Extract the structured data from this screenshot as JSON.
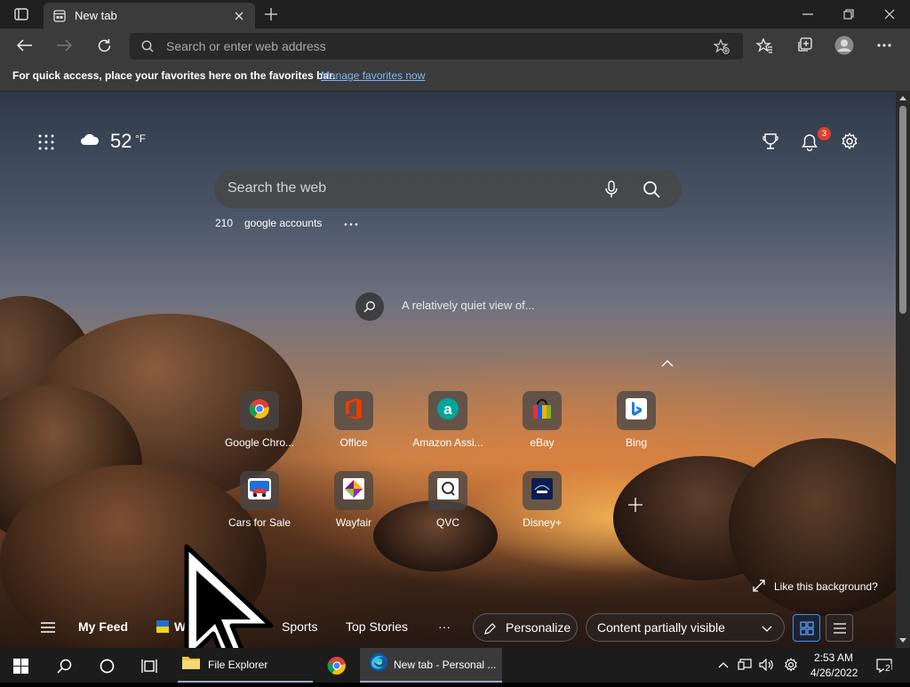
{
  "browser": {
    "tab_title": "New tab",
    "address_placeholder": "Search or enter web address",
    "favorites_message": "For quick access, place your favorites here on the favorites bar.",
    "favorites_link": "Manage favorites now"
  },
  "newtab": {
    "weather_temp": "52",
    "weather_unit": "°F",
    "notification_count": "3",
    "search_placeholder": "Search the web",
    "trending": [
      {
        "count": "210",
        "label": "google accounts"
      }
    ],
    "image_caption": "A relatively quiet view of...",
    "like_background": "Like this background?",
    "tiles": [
      {
        "label": "Google Chro...",
        "icon": "chrome-icon"
      },
      {
        "label": "Office",
        "icon": "office-icon"
      },
      {
        "label": "Amazon Assi...",
        "icon": "amazon-icon"
      },
      {
        "label": "eBay",
        "icon": "ebay-icon"
      },
      {
        "label": "Bing",
        "icon": "bing-icon"
      },
      {
        "label": "Cars for Sale",
        "icon": "car-icon"
      },
      {
        "label": "Wayfair",
        "icon": "wayfair-icon"
      },
      {
        "label": "QVC",
        "icon": "qvc-icon"
      },
      {
        "label": "Disney+",
        "icon": "disney-icon"
      }
    ],
    "feed": {
      "my_feed": "My Feed",
      "second_item": "W",
      "sports": "Sports",
      "top_stories": "Top Stories",
      "more": "···",
      "personalize": "Personalize",
      "content_visibility": "Content partially visible"
    }
  },
  "taskbar": {
    "file_explorer": "File Explorer",
    "file_explorer_partial_a": "File",
    "file_explorer_partial_b": "rer",
    "edge_window": "New tab - Personal ...",
    "time": "2:53 AM",
    "date": "4/26/2022",
    "notifications": "2"
  },
  "colors": {
    "accent": "#0078d4",
    "link": "#7cb8ff",
    "badge": "#e0402a"
  }
}
